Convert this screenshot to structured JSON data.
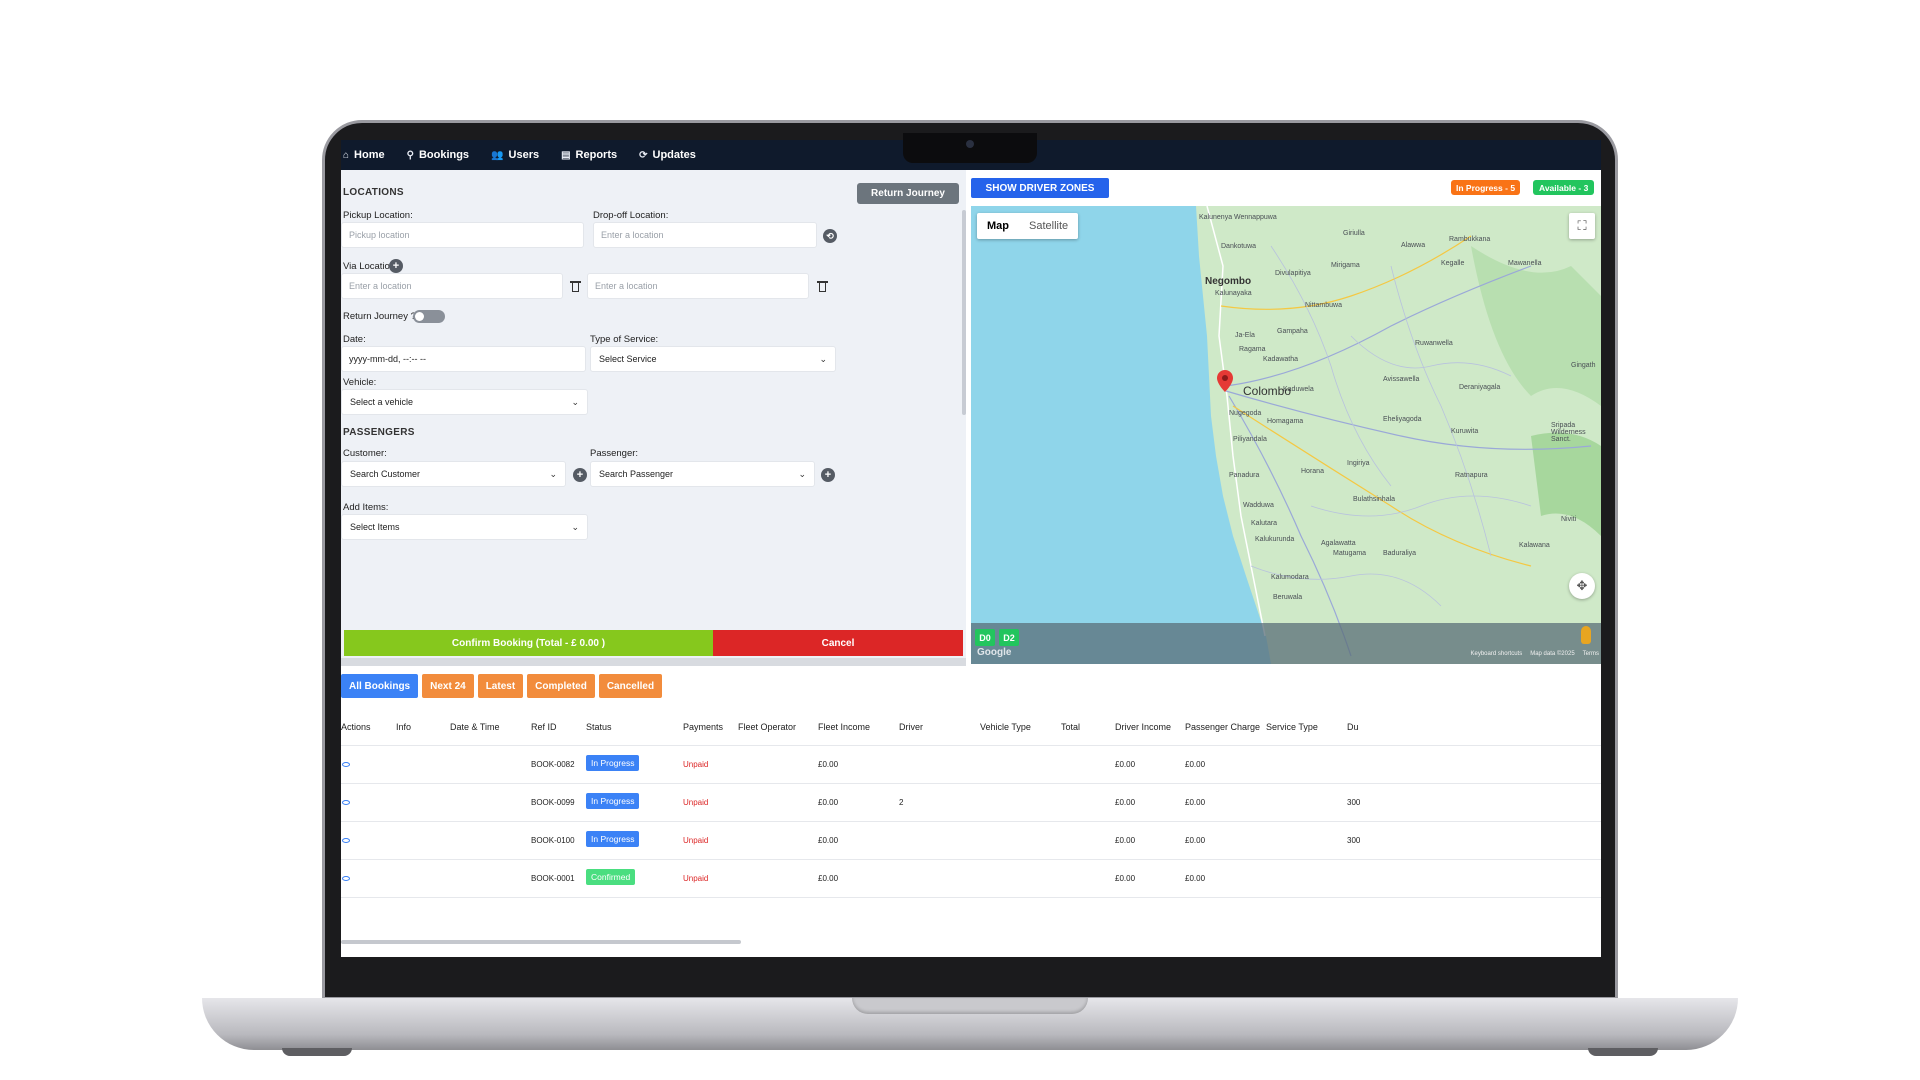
{
  "nav": {
    "items": [
      {
        "label": "Home",
        "icon": "home-icon"
      },
      {
        "label": "Bookings",
        "icon": "pin-icon"
      },
      {
        "label": "Users",
        "icon": "users-icon"
      },
      {
        "label": "Reports",
        "icon": "reports-icon"
      },
      {
        "label": "Updates",
        "icon": "updates-icon"
      }
    ]
  },
  "form": {
    "locations_title": "LOCATIONS",
    "return_journey_button": "Return Journey",
    "pickup_label": "Pickup Location:",
    "pickup_placeholder": "Pickup location",
    "dropoff_label": "Drop-off Location:",
    "dropoff_placeholder": "Enter a location",
    "via_label": "Via Locations:",
    "via_placeholder_1": "Enter a location",
    "via_placeholder_2": "Enter a location",
    "return_toggle_label": "Return Journey ?",
    "date_label": "Date:",
    "date_value": "yyyy-mm-dd, --:-- --",
    "service_label": "Type of Service:",
    "service_value": "Select Service",
    "vehicle_label": "Vehicle:",
    "vehicle_value": "Select a vehicle",
    "passengers_title": "PASSENGERS",
    "customer_label": "Customer:",
    "customer_value": "Search Customer",
    "passenger_label": "Passenger:",
    "passenger_value": "Search Passenger",
    "items_label": "Add Items:",
    "items_value": "Select Items",
    "confirm_button": "Confirm Booking (Total - £ 0.00 )",
    "cancel_button": "Cancel"
  },
  "map": {
    "zones_button": "SHOW DRIVER ZONES",
    "in_progress_badge": "In Progress - 5",
    "available_badge": "Available - 3",
    "tab_map": "Map",
    "tab_satellite": "Satellite",
    "driver_chips": [
      "D0",
      "D2"
    ],
    "google_label": "Google",
    "footer": [
      "Keyboard shortcuts",
      "Map data ©2025",
      "Terms"
    ],
    "labels": {
      "colombo": "Colombo",
      "negombo": "Negombo",
      "kurunegala_area": "Kalunayaka",
      "kaduwela": "Kaduwela",
      "avissawella": "Avissawella",
      "horana": "Horana",
      "panadura": "Panadura",
      "wadduwa": "Wadduwa",
      "kalutara": "Kalutara",
      "gampaha": "Gampaha",
      "ja_ela": "Ja-Ela",
      "ragama": "Ragama",
      "kadawatha": "Kadawatha",
      "nittambuwa": "Nittambuwa",
      "mirigama": "Mirigama",
      "divulapitiya": "Divulapitiya",
      "dankotuwa": "Dankotuwa",
      "kegalle": "Kegalle",
      "rambukkana": "Rambukkana",
      "ruwanwella": "Ruwanwella",
      "deraniyagala": "Deraniyagala",
      "eheliyagoda": "Eheliyagoda",
      "kuruwita": "Kuruwita",
      "ratnapura": "Ratnapura",
      "homagama": "Homagama",
      "piliyandala": "Piliyandala",
      "nugegoda": "Nugegoda",
      "ingiriya": "Ingiriya",
      "bulathsinhala": "Bulathsinhala",
      "kalawana": "Kalawana",
      "matugama": "Matugama",
      "agalawatta": "Agalawatta",
      "baduraliya": "Baduraliya",
      "kaluumodara": "Kalumodara",
      "beruwala": "Beruwala",
      "giriulla": "Giriulla",
      "alawwa": "Alawwa",
      "wennappuwa": "Kalunenya Wennappuwa",
      "mawanella": "Mawanella",
      "gingath": "Gingath",
      "sinharaja": "Sripada Wilderness Sanct.",
      "nivitigala": "Niviti",
      "kaluaggala": "Kalukurunda"
    }
  },
  "tabs": [
    {
      "label": "All Bookings",
      "active": true
    },
    {
      "label": "Next 24",
      "active": false
    },
    {
      "label": "Latest",
      "active": false
    },
    {
      "label": "Completed",
      "active": false
    },
    {
      "label": "Cancelled",
      "active": false
    }
  ],
  "table": {
    "headers": [
      "Actions",
      "Info",
      "Date & Time",
      "Ref ID",
      "Status",
      "Payments",
      "Fleet Operator",
      "Fleet Income",
      "Driver",
      "Vehicle Type",
      "Total",
      "Driver Income",
      "Passenger Charge",
      "Service Type",
      "Du"
    ],
    "rows": [
      {
        "ref": "BOOK-0082",
        "status": "In Progress",
        "payment": "Unpaid",
        "fleet_income": "£0.00",
        "driver": "",
        "driver_income": "£0.00",
        "passenger_charge": "£0.00",
        "extra": ""
      },
      {
        "ref": "BOOK-0099",
        "status": "In Progress",
        "payment": "Unpaid",
        "fleet_income": "£0.00",
        "driver": "2",
        "driver_income": "£0.00",
        "passenger_charge": "£0.00",
        "extra": "300"
      },
      {
        "ref": "BOOK-0100",
        "status": "In Progress",
        "payment": "Unpaid",
        "fleet_income": "£0.00",
        "driver": "",
        "driver_income": "£0.00",
        "passenger_charge": "£0.00",
        "extra": "300"
      },
      {
        "ref": "BOOK-0001",
        "status": "Confirmed",
        "payment": "Unpaid",
        "fleet_income": "£0.00",
        "driver": "",
        "driver_income": "£0.00",
        "passenger_charge": "£0.00",
        "extra": ""
      }
    ]
  }
}
